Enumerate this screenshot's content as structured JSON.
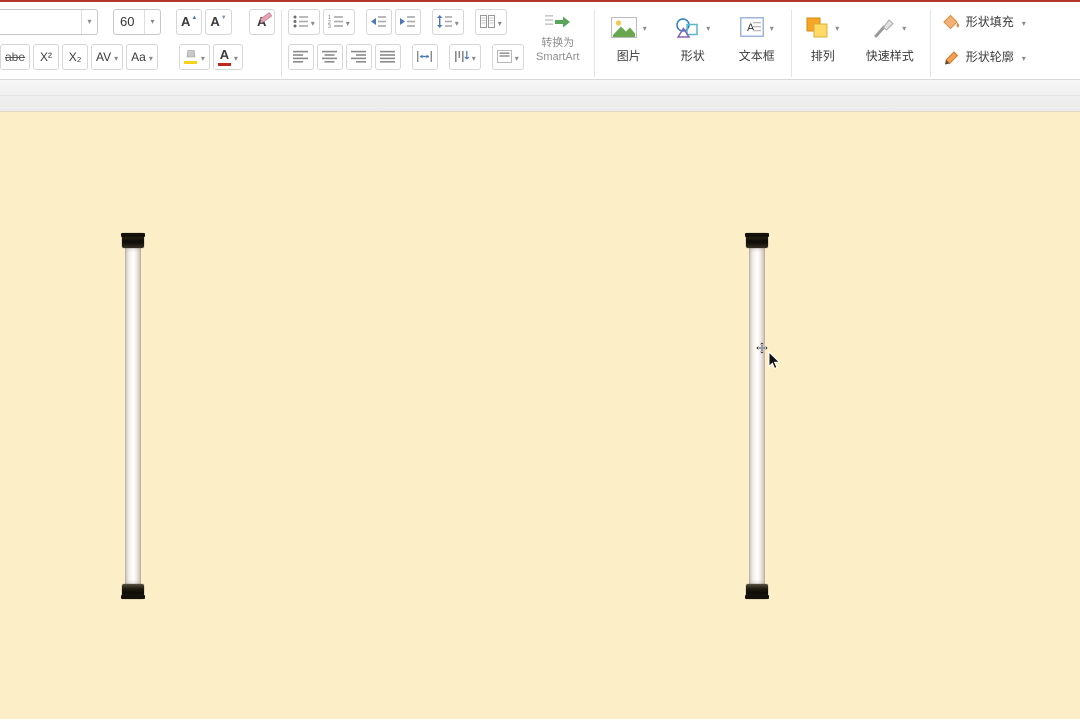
{
  "colors": {
    "top_line": "#b5372c",
    "slide_background": "#fcefc8",
    "accent_blue": "#4a78b8",
    "font_color_red": "#c0261c",
    "highlight_yellow": "#f6d21c"
  },
  "ribbon": {
    "font": {
      "name_value": "",
      "size_value": "60",
      "grow": "A",
      "shrink": "A",
      "clear": "A",
      "strikethrough": "abe",
      "superscript": "X²",
      "subscript": "X₂",
      "spacing": "AV",
      "change_case": "Aa",
      "color": "A"
    },
    "paragraph": {
      "smartart_line1": "转换为",
      "smartart_line2": "SmartArt"
    },
    "insert": {
      "picture": "图片",
      "shapes": "形状",
      "textbox": "文本框"
    },
    "arrange_group": {
      "arrange": "排列",
      "quick_styles": "快速样式"
    },
    "shape_group": {
      "fill": "形状填充",
      "outline": "形状轮廓"
    }
  },
  "icons": {
    "dropdown": "▾",
    "grow_arrow": "▲",
    "shrink_arrow": "▼"
  }
}
